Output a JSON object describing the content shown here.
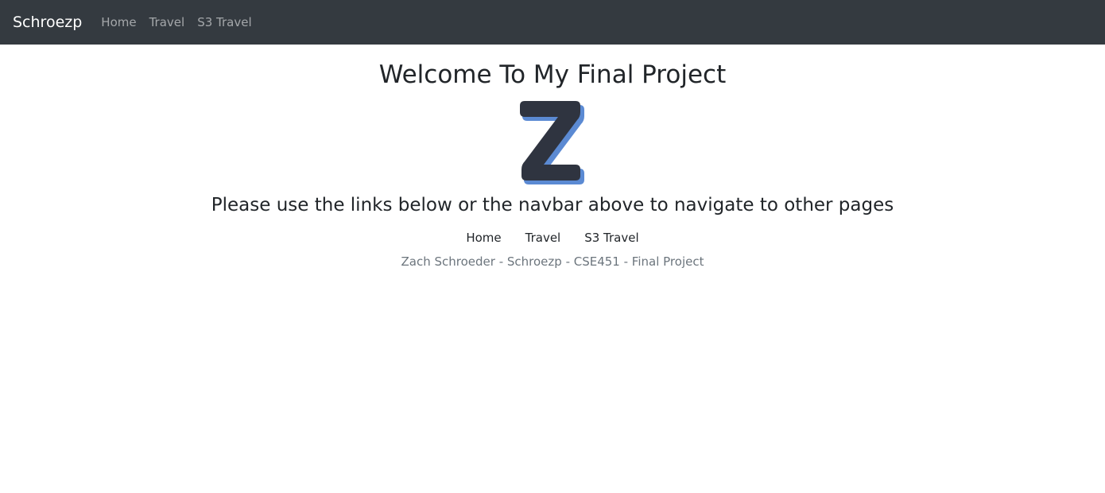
{
  "navbar": {
    "brand": "Schroezp",
    "links": [
      "Home",
      "Travel",
      "S3 Travel"
    ]
  },
  "main": {
    "title": "Welcome To My Final Project",
    "logo_icon": "letter-z-logo",
    "subtitle": "Please use the links below or the navbar above to navigate to other pages",
    "links": [
      "Home",
      "Travel",
      "S3 Travel"
    ],
    "credit": "Zach Schroeder - Schroezp - CSE451 - Final Project"
  },
  "colors": {
    "navbar_bg": "#343a40",
    "logo_dark": "#2f3440",
    "logo_accent": "#5b8ad3"
  }
}
